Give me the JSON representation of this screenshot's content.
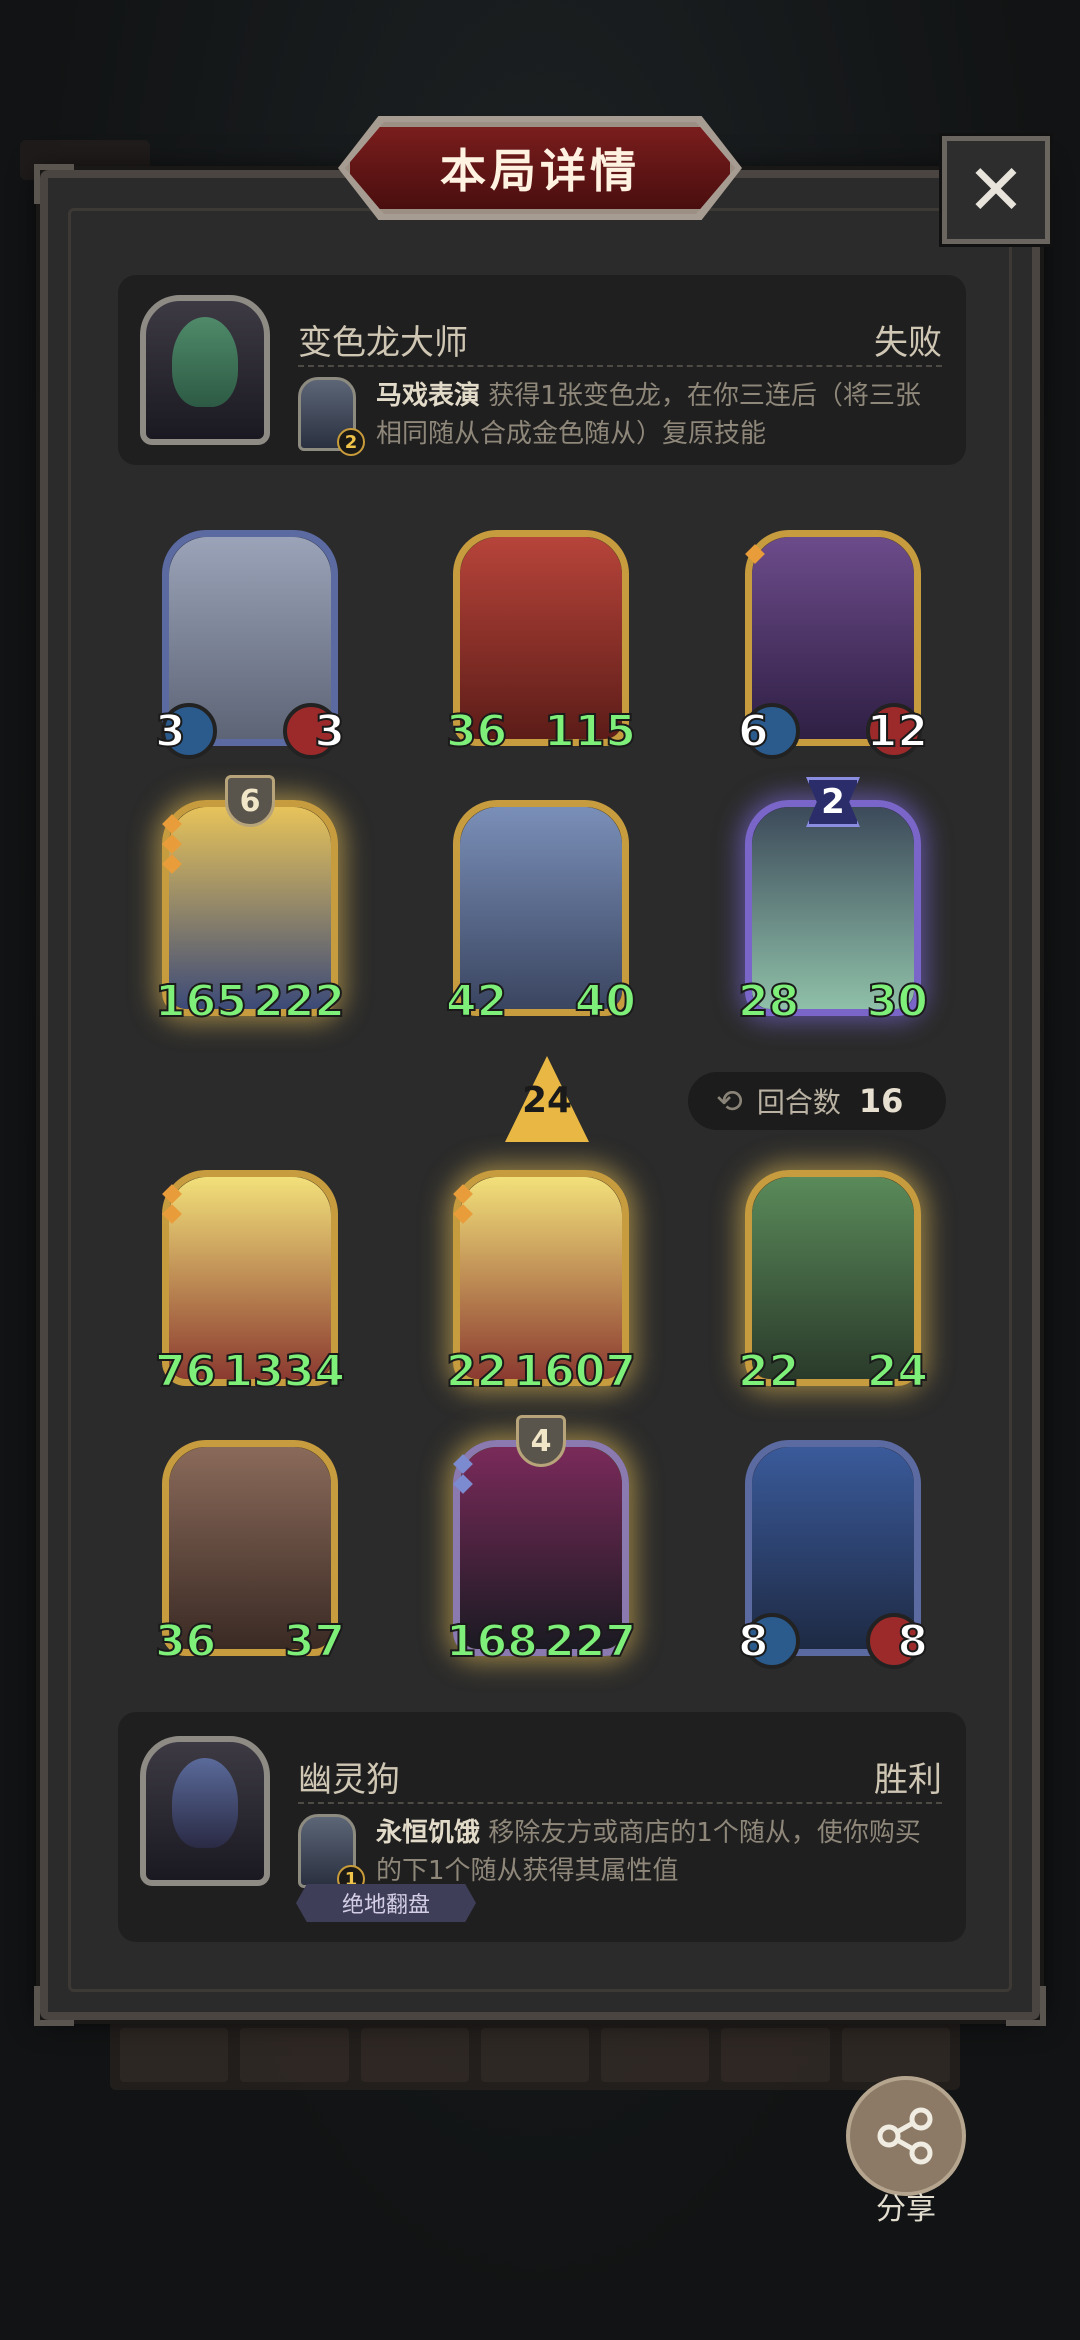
{
  "title": "本局详情",
  "close_icon": "close-icon",
  "top_hero": {
    "name": "变色龙大师",
    "result": "失败",
    "skill_level": "2",
    "skill_name": "马戏表演",
    "skill_desc": "获得1张变色龙，在你三连后（将三张相同随从合成金色随从）复原技能"
  },
  "board": {
    "top_row_1": [
      {
        "atk": "3",
        "hp": "3"
      },
      {
        "atk": "36",
        "hp": "115"
      },
      {
        "atk": "6",
        "hp": "12"
      }
    ],
    "top_row_2": [
      {
        "atk": "165",
        "hp": "222",
        "level": "6"
      },
      {
        "atk": "42",
        "hp": "40"
      },
      {
        "atk": "28",
        "hp": "30",
        "stars": "2"
      }
    ],
    "bottom_row_1": [
      {
        "atk": "76",
        "hp": "1334"
      },
      {
        "atk": "22",
        "hp": "1607"
      },
      {
        "atk": "22",
        "hp": "24"
      }
    ],
    "bottom_row_2": [
      {
        "atk": "36",
        "hp": "37"
      },
      {
        "atk": "168",
        "hp": "227",
        "level": "4"
      },
      {
        "atk": "8",
        "hp": "8"
      }
    ]
  },
  "turn_indicator": "24",
  "round": {
    "label": "回合数",
    "value": "16"
  },
  "bottom_hero": {
    "name": "幽灵狗",
    "result": "胜利",
    "skill_level": "1",
    "skill_name": "永恒饥饿",
    "skill_desc": "移除友方或商店的1个随从，使你购买的下1个随从获得其属性值",
    "tag": "绝地翻盘"
  },
  "share": {
    "label": "分享"
  }
}
